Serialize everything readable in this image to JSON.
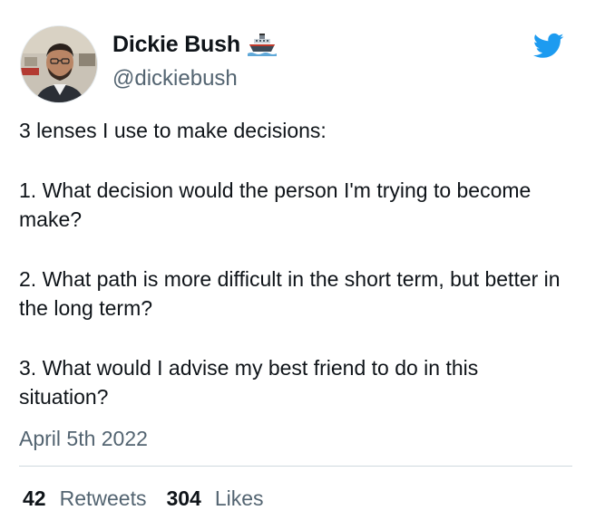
{
  "author": {
    "display_name": "Dickie Bush",
    "handle": "@dickiebush",
    "badge_icon": "ship-icon",
    "avatar": "avatar-photo"
  },
  "platform_icon": "twitter-bird-icon",
  "tweet": {
    "lines": [
      "3 lenses I use to make decisions:",
      "1. What decision would the person I'm trying to become make?",
      "2. What path is more difficult in the short term, but better in the long term?",
      "3. What would I advise my best friend to do in this situation?"
    ],
    "date": "April 5th 2022"
  },
  "stats": {
    "retweets_count": "42",
    "retweets_label": "Retweets",
    "likes_count": "304",
    "likes_label": "Likes"
  },
  "colors": {
    "twitter_blue": "#1d9bf0",
    "secondary_text": "#536471",
    "primary_text": "#0f1419",
    "divider": "#cfd9de"
  }
}
